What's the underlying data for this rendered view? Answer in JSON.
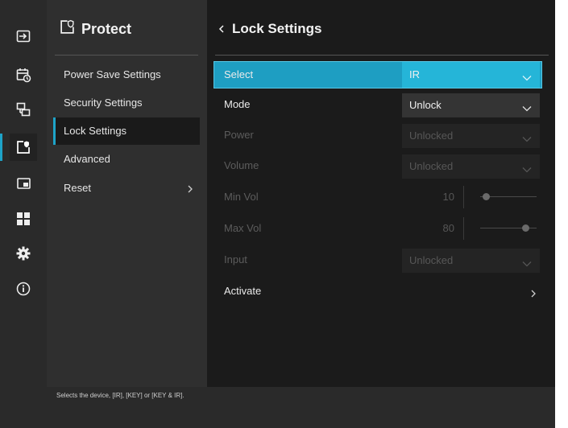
{
  "menu": {
    "title": "Protect",
    "items": [
      {
        "label": "Power Save Settings"
      },
      {
        "label": "Security Settings"
      },
      {
        "label": "Lock Settings"
      },
      {
        "label": "Advanced"
      },
      {
        "label": "Reset"
      }
    ],
    "active_index": 2
  },
  "panel": {
    "title": "Lock Settings",
    "rows": {
      "select": {
        "label": "Select",
        "value": "IR"
      },
      "mode": {
        "label": "Mode",
        "value": "Unlock"
      },
      "power": {
        "label": "Power",
        "value": "Unlocked"
      },
      "volume": {
        "label": "Volume",
        "value": "Unlocked"
      },
      "min_vol": {
        "label": "Min Vol",
        "value": "10",
        "level": 0.1
      },
      "max_vol": {
        "label": "Max Vol",
        "value": "80",
        "level": 0.8
      },
      "input": {
        "label": "Input",
        "value": "Unlocked"
      },
      "activate": {
        "label": "Activate"
      }
    }
  },
  "footer": {
    "help": "Selects the device, [IR], [KEY] or [KEY & IR]."
  },
  "rail_icons": [
    "input-icon",
    "schedule-icon",
    "multi-display-icon",
    "protect-icon",
    "pip-icon",
    "apps-icon",
    "settings-icon",
    "info-icon"
  ],
  "colors": {
    "accent": "#1ea3c8",
    "selected_row": "#1e9ec2",
    "selected_dropdown": "#25b5d8"
  }
}
